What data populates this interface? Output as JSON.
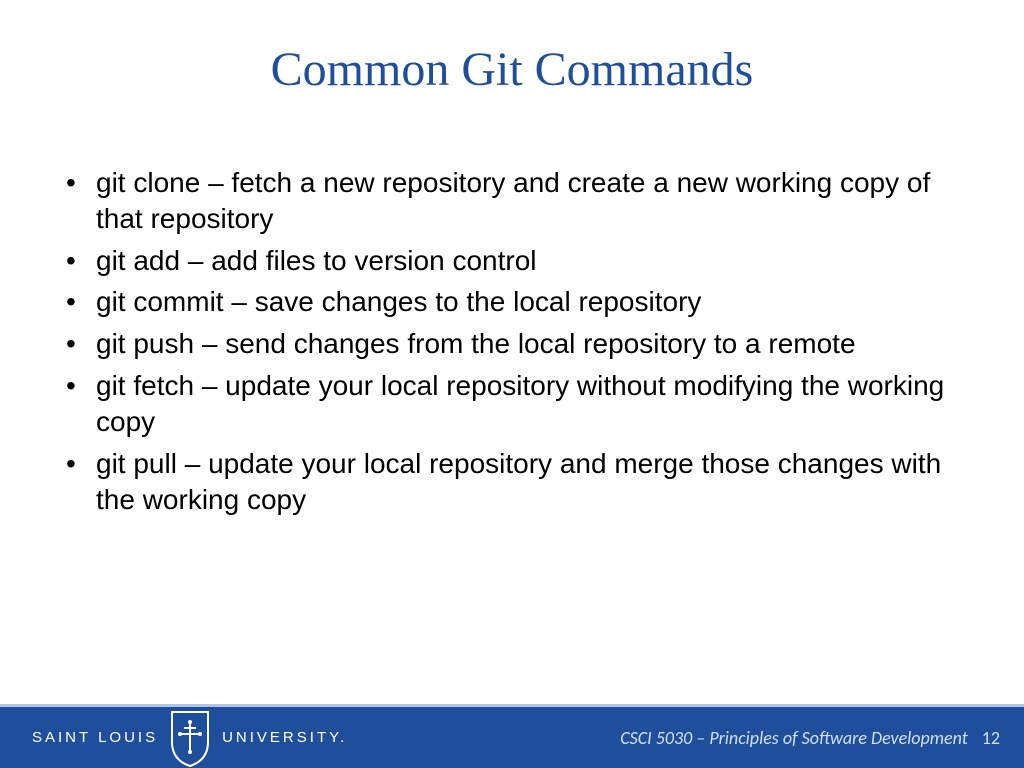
{
  "title": "Common Git Commands",
  "bullets": [
    "git clone – fetch a new repository and create a new working copy of that repository",
    "git add – add files to version control",
    "git commit – save changes to the local repository",
    "git push – send changes from the local repository to a remote",
    "git fetch – update your local repository without modifying the working copy",
    "git pull – update your local repository and merge those changes with the working copy"
  ],
  "footer": {
    "logo_left": "SAINT LOUIS",
    "logo_right": "UNIVERSITY.",
    "course": "CSCI 5030 – Principles of Software Development",
    "page": "12"
  }
}
